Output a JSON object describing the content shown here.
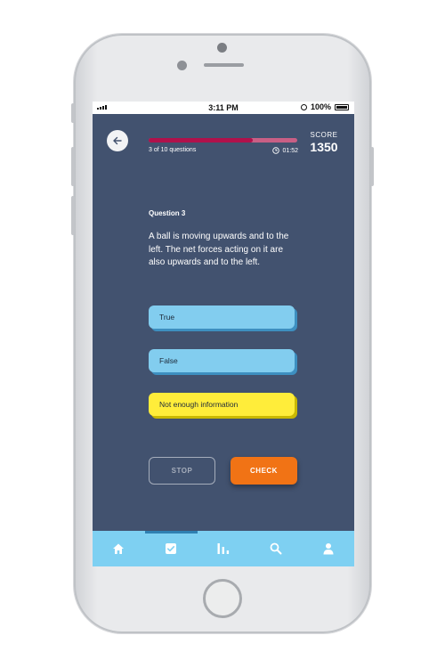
{
  "status_bar": {
    "time": "3:11 PM",
    "battery_text": "100%"
  },
  "quiz": {
    "progress_text": "3 of 10 questions",
    "progress_fraction": 0.7,
    "timer": "01:52",
    "score_label": "SCORE",
    "score_value": "1350",
    "question_title": "Question 3",
    "question_text": "A ball is moving upwards and to the left. The net forces acting on it are also upwards and to the left.",
    "answers": [
      {
        "label": "True",
        "state": "default"
      },
      {
        "label": "False",
        "state": "default"
      },
      {
        "label": "Not enough information",
        "state": "selected"
      }
    ],
    "stop_label": "STOP",
    "check_label": "CHECK"
  },
  "tabbar": {
    "active_index": 1,
    "items": [
      {
        "icon": "home-icon"
      },
      {
        "icon": "checkbox-icon"
      },
      {
        "icon": "bar-chart-icon"
      },
      {
        "icon": "search-icon"
      },
      {
        "icon": "user-icon"
      }
    ]
  },
  "colors": {
    "screen_bg": "#42526f",
    "progress_fill": "#b0114b",
    "answer_blue": "#82cdef",
    "answer_selected": "#ffed3a",
    "check_button": "#f17315",
    "tabbar_bg": "#7ed0f2"
  }
}
